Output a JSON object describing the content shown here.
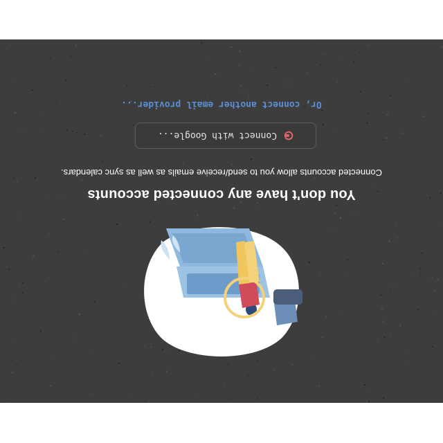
{
  "empty_state": {
    "title": "You don't have any connected accounts",
    "subtitle": "Connected accounts allow you to send/receive emails as well as sync calendars.",
    "connect_google_label": "Connect with Google...",
    "other_provider_label": "Or, connect another email provider..."
  },
  "colors": {
    "panel_background": "#3d3d3d",
    "link": "#5b8fd4",
    "google_icon": "#e06666"
  },
  "icons": {
    "illustration": "person-with-laptop-illustration",
    "connect_button_icon": "google-icon"
  }
}
